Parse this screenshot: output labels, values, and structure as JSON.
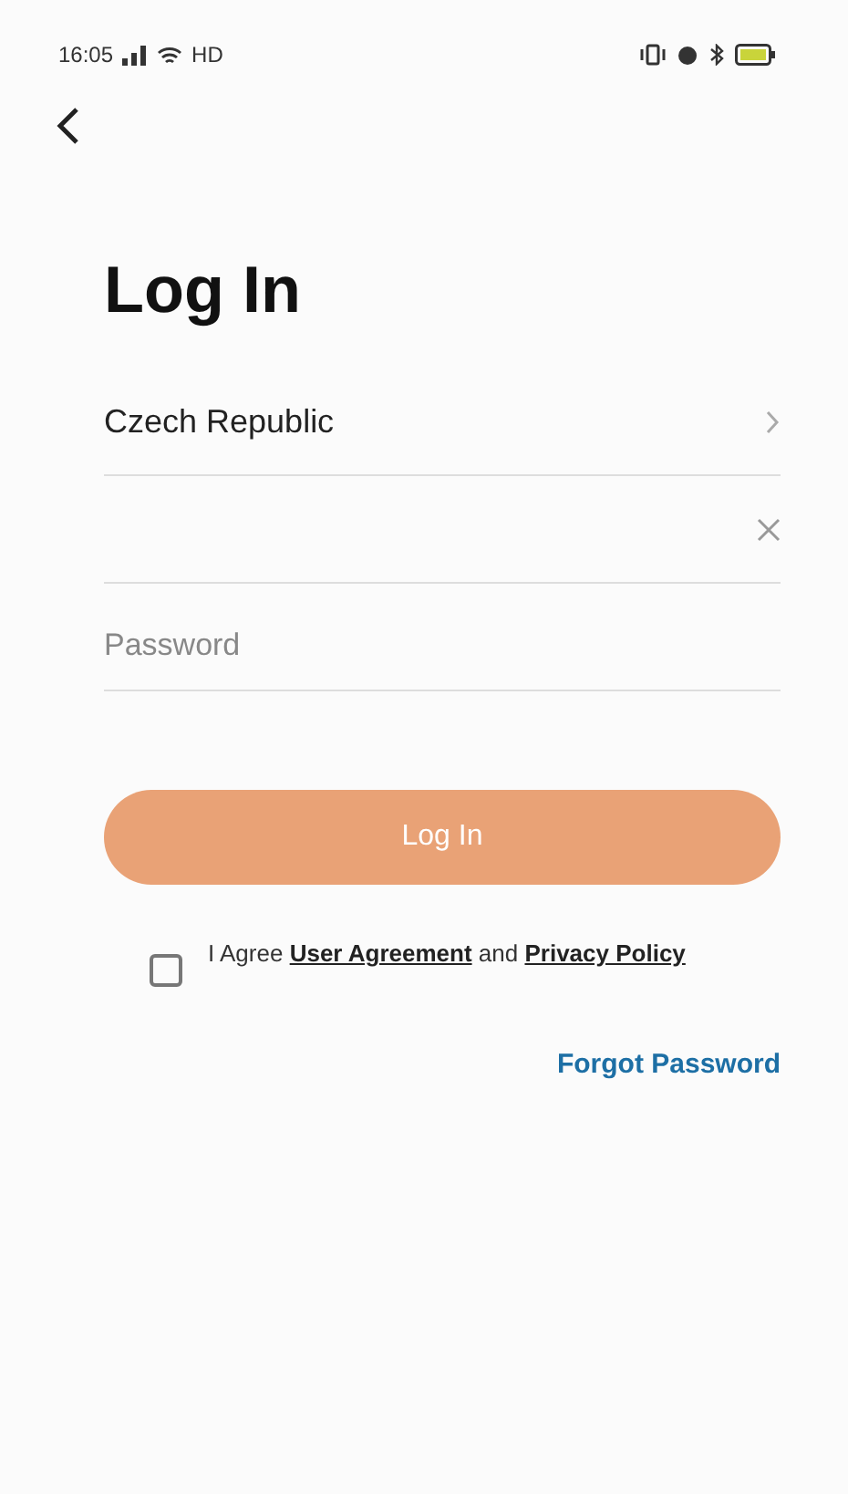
{
  "status_bar": {
    "time": "16:05",
    "network": "HD"
  },
  "title": "Log In",
  "country_field": {
    "value": "Czech Republic"
  },
  "password_field": {
    "placeholder": "Password"
  },
  "login_button": {
    "label": "Log In",
    "disabled": true
  },
  "agreement": {
    "checked": false,
    "prefix": "I Agree",
    "link_1": "User Agreement",
    "middle": "and",
    "link_2": "Privacy Policy"
  },
  "forgot_password": "Forgot Password"
}
